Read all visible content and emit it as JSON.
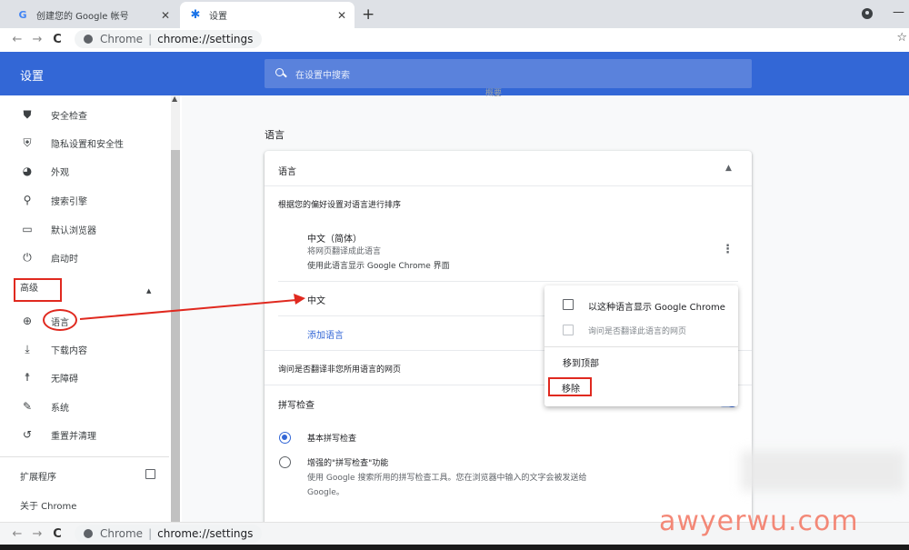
{
  "tabs": [
    {
      "title": "创建您的 Google 帐号",
      "favicon": "G",
      "active": false
    },
    {
      "title": "设置",
      "favicon": "gear-icon",
      "active": true
    }
  ],
  "omnibox": {
    "site": "Chrome",
    "url": "chrome://settings"
  },
  "header": {
    "title": "设置",
    "search_placeholder": "在设置中搜索",
    "color": "#3367d6"
  },
  "sidebar": {
    "items": [
      {
        "label": "安全检查",
        "icon": "shield-check-icon"
      },
      {
        "label": "隐私设置和安全性",
        "icon": "shield-icon"
      },
      {
        "label": "外观",
        "icon": "palette-icon"
      },
      {
        "label": "搜索引擎",
        "icon": "search-icon"
      },
      {
        "label": "默认浏览器",
        "icon": "browser-icon"
      },
      {
        "label": "启动时",
        "icon": "power-icon"
      }
    ],
    "advanced_label": "高级",
    "advanced_items": [
      {
        "label": "语言",
        "icon": "globe-icon"
      },
      {
        "label": "下载内容",
        "icon": "download-icon"
      },
      {
        "label": "无障碍",
        "icon": "accessibility-icon"
      },
      {
        "label": "系统",
        "icon": "wrench-icon"
      },
      {
        "label": "重置并清理",
        "icon": "restore-icon"
      }
    ],
    "extensions_label": "扩展程序",
    "about_label": "关于 Chrome"
  },
  "main": {
    "faded_text": "概要",
    "section_title": "语言",
    "card": {
      "header": "语言",
      "order_desc": "根据您的偏好设置对语言进行排序",
      "lang1": {
        "name": "中文（简体）",
        "line2": "将网页翻译成此语言",
        "line3": "使用此语言显示 Google Chrome 界面"
      },
      "lang2": {
        "name": "中文"
      },
      "add_language": "添加语言",
      "offer_translate": "询问是否翻译非您所用语言的网页",
      "spellcheck": "拼写检查",
      "basic_spell": "基本拼写检查",
      "enhanced_spell": "增强的\"拼写检查\"功能",
      "enhanced_desc1": "使用 Google 搜索所用的拼写检查工具。您在浏览器中输入的文字会被发送给",
      "enhanced_desc2": "Google。"
    }
  },
  "context_menu": {
    "display_chrome": "以这种语言显示 Google Chrome",
    "offer_translate": "询问是否翻译此语言的网页",
    "move_top": "移到顶部",
    "remove": "移除"
  },
  "watermark": "awyerwu.com",
  "annotation_color": "#e0291f"
}
